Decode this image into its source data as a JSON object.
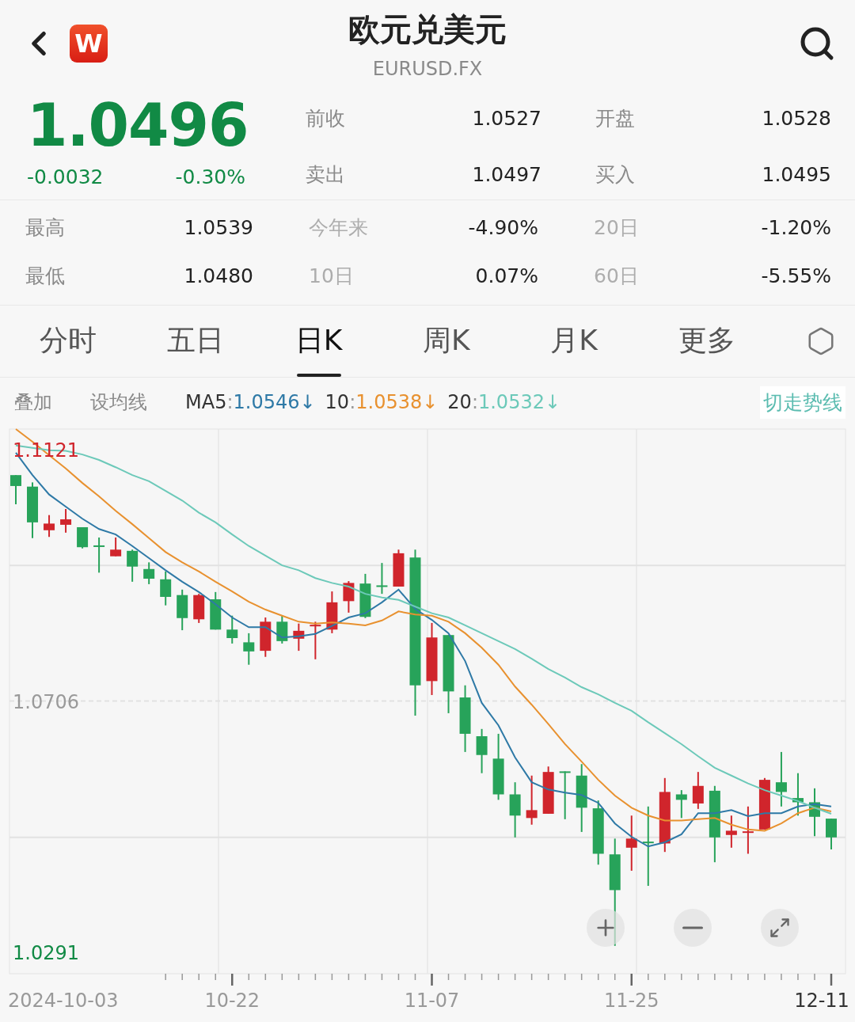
{
  "header": {
    "logo": "W",
    "title": "欧元兑美元",
    "subtitle": "EURUSD.FX"
  },
  "quote": {
    "price": "1.0496",
    "change": "-0.0032",
    "change_pct": "-0.30%"
  },
  "quote_stats": [
    {
      "label": "前收",
      "value": "1.0527"
    },
    {
      "label": "开盘",
      "value": "1.0528"
    },
    {
      "label": "卖出",
      "value": "1.0497"
    },
    {
      "label": "买入",
      "value": "1.0495"
    }
  ],
  "stats": [
    {
      "label": "最高",
      "value": "1.0539",
      "muted": false
    },
    {
      "label": "今年来",
      "value": "-4.90%",
      "muted": true
    },
    {
      "label": "20日",
      "value": "-1.20%",
      "muted": true
    },
    {
      "label": "最低",
      "value": "1.0480",
      "muted": false
    },
    {
      "label": "10日",
      "value": "0.07%",
      "muted": true
    },
    {
      "label": "60日",
      "value": "-5.55%",
      "muted": true
    }
  ],
  "tabs": [
    {
      "label": "分时",
      "selected": false
    },
    {
      "label": "五日",
      "selected": false
    },
    {
      "label": "日K",
      "selected": true
    },
    {
      "label": "周K",
      "selected": false
    },
    {
      "label": "月K",
      "selected": false
    },
    {
      "label": "更多",
      "selected": false
    }
  ],
  "toolbar": {
    "overlay": "叠加",
    "set_ma": "设均线",
    "switch": "切走势线"
  },
  "legend": [
    {
      "sep": ":",
      "value": "1.0546",
      "arrow": "↓"
    },
    {
      "sep": ":",
      "value": "1.0538",
      "arrow": "↓"
    },
    {
      "sep": ":",
      "value": "1.0532",
      "arrow": "↓"
    }
  ],
  "chart_data": {
    "type": "candlestick",
    "ylim": [
      1.0256,
      1.1155
    ],
    "annotations": [
      "2024-10-03"
    ],
    "ref_lines": [
      {
        "axis": "y",
        "value": 1.093
      },
      {
        "axis": "y",
        "value": 1.0706
      },
      {
        "axis": "y",
        "value": 1.0481
      }
    ],
    "categories": [
      null,
      null,
      null,
      null,
      null,
      null,
      null,
      null,
      null,
      null,
      null,
      null,
      null,
      "10-22",
      null,
      null,
      null,
      null,
      null,
      null,
      null,
      null,
      null,
      null,
      null,
      "11-07",
      null,
      null,
      null,
      null,
      null,
      null,
      null,
      null,
      null,
      null,
      null,
      "11-25",
      null,
      null,
      null,
      null,
      null,
      null,
      null,
      null,
      null,
      null,
      null,
      "12-11"
    ],
    "yticks": [
      {
        "value": 1.1121,
        "label": "1.1121"
      },
      {
        "value": 1.0706,
        "label": "1.0706"
      },
      {
        "value": 1.0291,
        "label": "1.0291"
      }
    ],
    "ohlc": [
      [
        1.1079,
        1.1079,
        1.1031,
        1.1061
      ],
      [
        1.106,
        1.1067,
        1.0975,
        1.1001
      ],
      [
        1.0988,
        1.1013,
        1.0977,
        1.0999
      ],
      [
        1.0997,
        1.1023,
        1.0984,
        1.1006
      ],
      [
        1.0993,
        1.0993,
        1.0958,
        1.096
      ],
      [
        1.0963,
        1.0976,
        1.0918,
        1.0962
      ],
      [
        1.0945,
        1.0976,
        1.0945,
        1.0956
      ],
      [
        1.0954,
        1.0956,
        1.0903,
        1.0928
      ],
      [
        1.0924,
        1.0935,
        1.0899,
        1.0908
      ],
      [
        1.0907,
        1.092,
        1.0864,
        1.0878
      ],
      [
        1.0881,
        1.089,
        1.0823,
        1.0843
      ],
      [
        1.0841,
        1.0883,
        1.0835,
        1.0881
      ],
      [
        1.0874,
        1.0886,
        1.0824,
        1.0824
      ],
      [
        1.0824,
        1.0847,
        1.0801,
        1.081
      ],
      [
        1.0803,
        1.0818,
        1.0766,
        1.0788
      ],
      [
        1.0789,
        1.0844,
        1.0779,
        1.0837
      ],
      [
        1.0837,
        1.0847,
        1.0801,
        1.0805
      ],
      [
        1.0809,
        1.0834,
        1.0789,
        1.0822
      ],
      [
        1.083,
        1.0837,
        1.0775,
        1.0832
      ],
      [
        1.0824,
        1.0887,
        1.0818,
        1.0869
      ],
      [
        1.0871,
        1.0904,
        1.0852,
        1.0901
      ],
      [
        1.09,
        1.0916,
        1.0843,
        1.0845
      ],
      [
        1.0897,
        1.0934,
        1.0883,
        1.0896
      ],
      [
        1.0895,
        1.0956,
        1.0895,
        1.095
      ],
      [
        1.0943,
        1.0956,
        1.0682,
        1.0732
      ],
      [
        1.0739,
        1.0835,
        1.0716,
        1.0811
      ],
      [
        1.0815,
        1.0815,
        1.0686,
        1.0722
      ],
      [
        1.0712,
        1.0732,
        1.0622,
        1.0652
      ],
      [
        1.0648,
        1.066,
        1.0587,
        1.0617
      ],
      [
        1.0611,
        1.0652,
        1.0543,
        1.0552
      ],
      [
        1.0552,
        1.0572,
        1.0481,
        1.0517
      ],
      [
        1.0513,
        1.0583,
        1.0502,
        1.0526
      ],
      [
        1.052,
        1.0598,
        1.052,
        1.0589
      ],
      [
        1.059,
        1.059,
        1.0511,
        1.0589
      ],
      [
        1.0583,
        1.0602,
        1.049,
        1.053
      ],
      [
        1.0529,
        1.0542,
        1.0436,
        1.0454
      ],
      [
        1.0453,
        1.0479,
        1.0302,
        1.0394
      ],
      [
        1.0464,
        1.0517,
        1.0426,
        1.0479
      ],
      [
        1.0474,
        1.0532,
        1.0401,
        1.0473
      ],
      [
        1.0471,
        1.0579,
        1.0457,
        1.0556
      ],
      [
        1.0552,
        1.0559,
        1.0513,
        1.0543
      ],
      [
        1.0537,
        1.0589,
        1.0528,
        1.0566
      ],
      [
        1.0558,
        1.0566,
        1.044,
        1.0481
      ],
      [
        1.0485,
        1.0517,
        1.0464,
        1.0492
      ],
      [
        1.049,
        1.0532,
        1.0454,
        1.0491
      ],
      [
        1.0494,
        1.0579,
        1.0494,
        1.0576
      ],
      [
        1.0572,
        1.0622,
        1.0532,
        1.0556
      ],
      [
        1.0546,
        1.0587,
        1.0517,
        1.0539
      ],
      [
        1.0539,
        1.0562,
        1.0483,
        1.0515
      ],
      [
        1.0512,
        1.0512,
        1.0461,
        1.0481
      ]
    ],
    "series": [
      {
        "name": "MA5",
        "type": "line",
        "color": "#2e79a6",
        "values": [
          1.1116,
          1.1079,
          1.1047,
          1.1027,
          1.1007,
          1.099,
          1.0981,
          1.0962,
          1.0942,
          1.0922,
          1.0903,
          1.0886,
          1.0866,
          1.0844,
          1.0828,
          1.0828,
          1.0811,
          1.0813,
          1.0817,
          1.083,
          1.0844,
          1.0851,
          1.0869,
          1.089,
          1.0858,
          1.084,
          1.0818,
          1.0772,
          1.0703,
          1.0666,
          1.0613,
          1.0572,
          1.056,
          1.0555,
          1.0551,
          1.0538,
          1.0504,
          1.0482,
          1.0466,
          1.0473,
          1.0486,
          1.0521,
          1.0521,
          1.0526,
          1.0516,
          1.0521,
          1.0521,
          1.0532,
          1.0536,
          1.0532
        ]
      },
      {
        "name": "10",
        "type": "line",
        "color": "#e8912f",
        "values": [
          1.1155,
          1.1134,
          1.1112,
          1.109,
          1.1066,
          1.1044,
          1.102,
          1.0998,
          1.0975,
          1.0952,
          1.0935,
          1.092,
          1.0903,
          1.0887,
          1.087,
          1.0857,
          1.0847,
          1.0837,
          1.0834,
          1.0836,
          1.0834,
          1.0831,
          1.0839,
          1.0854,
          1.0849,
          1.0847,
          1.0837,
          1.0818,
          1.0794,
          1.0766,
          1.073,
          1.07,
          1.0668,
          1.0635,
          1.0606,
          1.0576,
          1.055,
          1.053,
          1.0517,
          1.0509,
          1.0509,
          1.0511,
          1.0513,
          1.0502,
          1.0494,
          1.0492,
          1.0504,
          1.0521,
          1.053,
          1.0524
        ]
      },
      {
        "name": "20",
        "type": "line",
        "color": "#6cc9b9",
        "values": [
          1.1128,
          1.1124,
          1.112,
          1.1119,
          1.1113,
          1.1104,
          1.1092,
          1.1079,
          1.1069,
          1.1053,
          1.1037,
          1.1017,
          1.1001,
          1.0981,
          1.0962,
          1.0946,
          1.093,
          1.0922,
          1.0909,
          1.0901,
          1.0895,
          1.0883,
          1.0877,
          1.0873,
          1.0862,
          1.0851,
          1.0844,
          1.0831,
          1.0818,
          1.0805,
          1.0792,
          1.0776,
          1.0759,
          1.0745,
          1.0729,
          1.0717,
          1.0703,
          1.069,
          1.0671,
          1.0653,
          1.0635,
          1.0615,
          1.0596,
          1.0583,
          1.057,
          1.0559,
          1.055,
          1.0541,
          1.053,
          1.052
        ]
      }
    ]
  },
  "zoom_controls": [
    {
      "kind": "zoom-in"
    },
    {
      "kind": "zoom-out"
    },
    {
      "kind": "expand"
    }
  ]
}
